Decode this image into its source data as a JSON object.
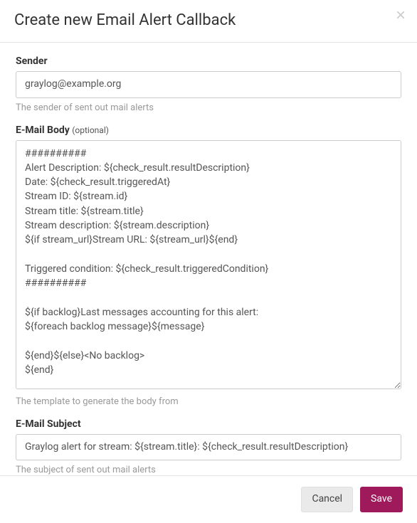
{
  "modal": {
    "title": "Create new Email Alert Callback",
    "close_label": "×"
  },
  "form": {
    "sender": {
      "label": "Sender",
      "value": "graylog@example.org",
      "help": "The sender of sent out mail alerts"
    },
    "body": {
      "label": "E-Mail Body",
      "optional": "(optional)",
      "value": "##########\nAlert Description: ${check_result.resultDescription}\nDate: ${check_result.triggeredAt}\nStream ID: ${stream.id}\nStream title: ${stream.title}\nStream description: ${stream.description}\n${if stream_url}Stream URL: ${stream_url}${end}\n\nTriggered condition: ${check_result.triggeredCondition}\n##########\n\n${if backlog}Last messages accounting for this alert:\n${foreach backlog message}${message}\n\n${end}${else}<No backlog>\n${end}\n",
      "help": "The template to generate the body from"
    },
    "subject": {
      "label": "E-Mail Subject",
      "value": "Graylog alert for stream: ${stream.title}: ${check_result.resultDescription}",
      "help": "The subject of sent out mail alerts"
    }
  },
  "footer": {
    "cancel": "Cancel",
    "save": "Save"
  }
}
